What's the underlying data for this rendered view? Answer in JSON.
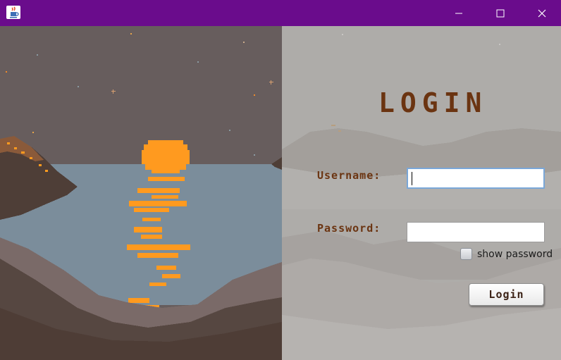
{
  "window": {
    "icon": "java-cup-icon",
    "controls": {
      "minimize": "minimize-icon",
      "maximize": "maximize-icon",
      "close": "close-icon"
    },
    "titlebar_color": "#6a0c8c"
  },
  "artwork": {
    "left": "pixel-sunset-lake-illustration",
    "right": "faded-mountain-mist-illustration",
    "sun_color": "#ff9a1f"
  },
  "login": {
    "title": "LOGIN",
    "username_label": "Username:",
    "username_value": "",
    "password_label": "Password:",
    "password_value": "",
    "show_password_label": "show password",
    "show_password_checked": false,
    "button_label": "Login",
    "text_color": "#6b3411"
  }
}
